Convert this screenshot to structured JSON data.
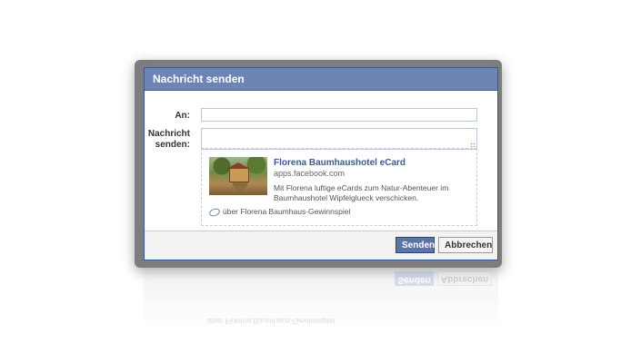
{
  "dialog": {
    "title": "Nachricht senden",
    "to_label": "An:",
    "to_value": "",
    "message_label_line1": "Nachricht",
    "message_label_line2": "senden:",
    "message_value": ""
  },
  "attachment": {
    "app_title": "Florena Baumhaushotel eCard",
    "app_domain": "apps.facebook.com",
    "description_line1": "Mit Florena luftige eCards zum Natur-Abenteuer im",
    "description_line2": "Baumhaushotel Wipfelglueck verschicken.",
    "via_text": "über Florena Baumhaus-Gewinnspiel",
    "via_icon": "link-icon",
    "thumbnail": "treehouse-thumbnail"
  },
  "footer": {
    "send_label": "Senden",
    "cancel_label": "Abbrechen"
  },
  "colors": {
    "header_bg": "#6d84b4",
    "brand_blue": "#3b5998",
    "send_button": "#5b74a8"
  }
}
